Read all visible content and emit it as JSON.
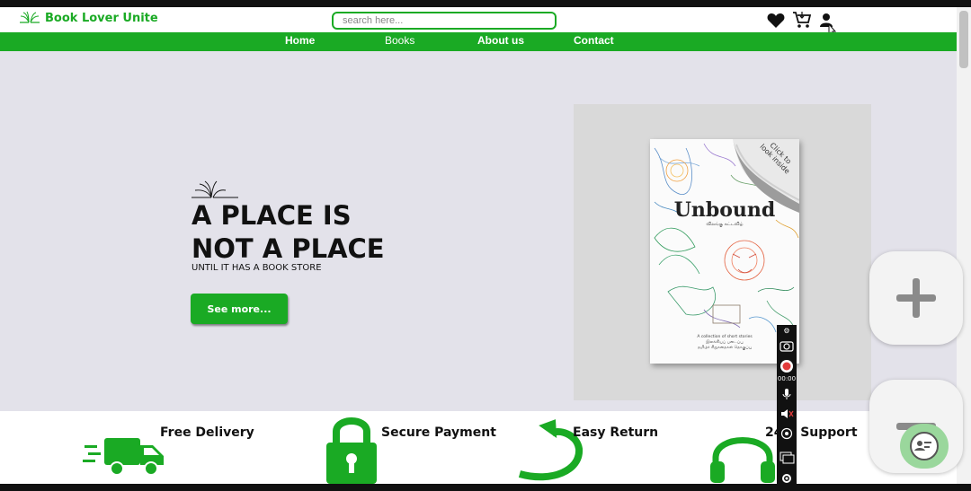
{
  "header": {
    "logo_text": "Book Lover Unite",
    "search_placeholder": "search here...",
    "icons": [
      "heart-icon",
      "cart-icon",
      "user-icon"
    ]
  },
  "nav": {
    "items": [
      {
        "label": "Home"
      },
      {
        "label": "Books"
      },
      {
        "label": "About us"
      },
      {
        "label": "Contact"
      }
    ]
  },
  "hero": {
    "title_line1": "A PLACE IS",
    "title_line2": "NOT A PLACE",
    "subtitle": "UNTIL IT HAS A BOOK STORE",
    "button_label": "See more..."
  },
  "book": {
    "title": "Unbound",
    "peel_text": "Click to look inside",
    "tamil_line": "விலங்கு  கட்டவிழ்",
    "caption_line1": "A collection of short stories",
    "caption_line2": "இலக்கியப் படைப்பு",
    "caption_line3": "தமிழ்ச் சிறுகதைகள் தொகுப்பு"
  },
  "features": [
    {
      "label": "Free Delivery",
      "icon": "delivery-truck-icon"
    },
    {
      "label": "Secure Payment",
      "icon": "padlock-icon"
    },
    {
      "label": "Easy Return",
      "icon": "return-arrow-icon"
    },
    {
      "label": "24/7 Support",
      "icon": "headphones-icon"
    }
  ],
  "recorder": {
    "timer": "00:00"
  },
  "colors": {
    "brand_green": "#1aaa24",
    "hero_bg": "#e3e2ea",
    "book_panel_bg": "#d9d9d9"
  }
}
